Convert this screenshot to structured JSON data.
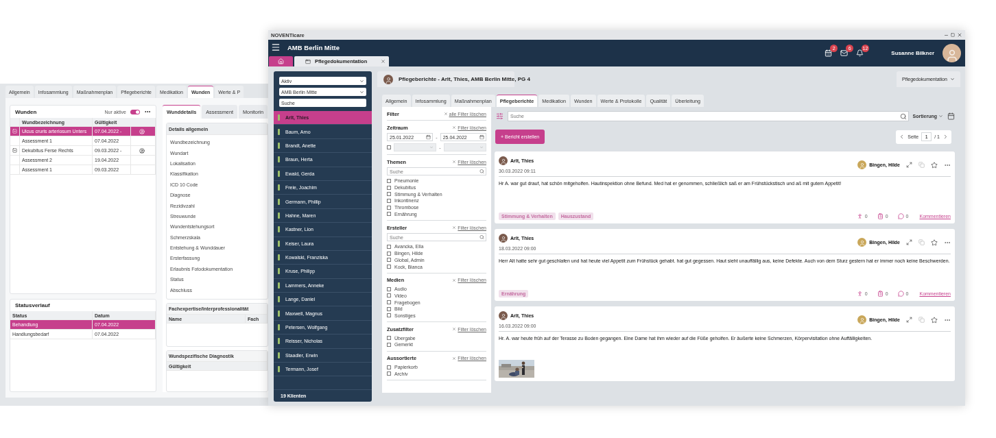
{
  "back_window": {
    "tabs": [
      {
        "label": "Allgemein",
        "selected": false
      },
      {
        "label": "Infosammlung",
        "selected": false
      },
      {
        "label": "Maßnahmenplan",
        "selected": false
      },
      {
        "label": "Pflegeberichte",
        "selected": false
      },
      {
        "label": "Medikation",
        "selected": false
      },
      {
        "label": "Wunden",
        "selected": true
      },
      {
        "label": "Werte & P",
        "selected": false
      }
    ],
    "wounds": {
      "title": "Wunden",
      "toggle_label": "Nur aktive",
      "toggle_on": true,
      "columns": [
        "Wundbezeichnung",
        "Gültigkeit"
      ],
      "rows": [
        {
          "name": "Ulcus cruris arteriosum Unters",
          "date": "07.04.2022 -",
          "selected": true,
          "expanded": true,
          "children": [
            {
              "name": "Assessment 1",
              "date": "07.04.2022",
              "selected": false
            }
          ]
        },
        {
          "name": "Dekubitus Ferse Rechts",
          "date": "09.03.2022 -",
          "selected": false,
          "expanded": true,
          "children": [
            {
              "name": "Assessment 2",
              "date": "19.04.2022",
              "selected": false
            },
            {
              "name": "Assessment 1",
              "date": "09.03.2022",
              "selected": false
            }
          ]
        }
      ]
    },
    "status": {
      "title": "Statusverlauf",
      "columns": [
        "Status",
        "Datum"
      ],
      "rows": [
        {
          "status": "Behandlung",
          "date": "07.04.2022",
          "selected": true
        },
        {
          "status": "Handlungsbedarf",
          "date": "07.04.2022",
          "selected": false
        }
      ]
    },
    "detail_tabs": [
      {
        "label": "Wunddetails",
        "selected": true
      },
      {
        "label": "Assessment",
        "selected": false
      },
      {
        "label": "Monitorin",
        "selected": false
      }
    ],
    "details": {
      "title": "Details allgemein",
      "fields": [
        "Wundbezeichnung",
        "Wundart",
        "Lokalisation",
        "Klassifikation",
        "ICD 10 Code",
        "Diagnose",
        "Rezidivzahl",
        "Streuwunde",
        "Wundentstehungsort",
        "Schmerzskala",
        "Entstehung & Wunddauer",
        "Ersterfassung",
        "Erlaubnis Fotodokumentation",
        "Status",
        "Abschluss"
      ]
    },
    "expertise": {
      "title": "Fachexpertise/Interprofessionalität",
      "columns": [
        "Name",
        "Fach"
      ]
    },
    "diagnostics": {
      "title": "Wundspezifische Diagnostik",
      "columns": [
        "Gültigkeit"
      ]
    }
  },
  "window": {
    "title": "NOVENTIcare",
    "location": "AMB Berlin Mitte",
    "doc_tab": "Pflegedokumentation",
    "user": "Susanne Bilkner",
    "notifications": [
      {
        "kind": "calendar",
        "count": "2"
      },
      {
        "kind": "mail",
        "count": "6"
      },
      {
        "kind": "bell",
        "count": "12"
      }
    ]
  },
  "clients": {
    "status_select": "Aktiv",
    "location_select": "AMB Berlin Mitte",
    "search_placeholder": "Suche",
    "items": [
      {
        "name": "Arlt, Thies",
        "selected": true
      },
      {
        "name": "Baum, Arno",
        "selected": false
      },
      {
        "name": "Brandt, Anette",
        "selected": false
      },
      {
        "name": "Braun, Herta",
        "selected": false
      },
      {
        "name": "Ewald, Gerda",
        "selected": false
      },
      {
        "name": "Freie, Joachim",
        "selected": false
      },
      {
        "name": "Germann, Phillip",
        "selected": false
      },
      {
        "name": "Hahne, Maren",
        "selected": false
      },
      {
        "name": "Kastner, Lion",
        "selected": false
      },
      {
        "name": "Keiser, Laura",
        "selected": false
      },
      {
        "name": "Kowalski, Franziska",
        "selected": false
      },
      {
        "name": "Kruse, Philipp",
        "selected": false
      },
      {
        "name": "Lammers, Anneke",
        "selected": false
      },
      {
        "name": "Lange, Daniel",
        "selected": false
      },
      {
        "name": "Maxwell, Magnus",
        "selected": false
      },
      {
        "name": "Petersen, Wolfgang",
        "selected": false
      },
      {
        "name": "Reisser, Nicholas",
        "selected": false
      },
      {
        "name": "Staadler, Erwin",
        "selected": false
      },
      {
        "name": "Termann, Josef",
        "selected": false
      }
    ],
    "footer": "19 Klienten"
  },
  "header": {
    "title": "Pflegeberichte - Arlt, Thies, AMB Berlin Mitte, PG 4",
    "module": "Pflegedokumentation"
  },
  "tabs": [
    {
      "label": "Allgemein",
      "selected": false
    },
    {
      "label": "Infosammlung",
      "selected": false
    },
    {
      "label": "Maßnahmenplan",
      "selected": false
    },
    {
      "label": "Pflegeberichte",
      "selected": true
    },
    {
      "label": "Medikation",
      "selected": false
    },
    {
      "label": "Wunden",
      "selected": false
    },
    {
      "label": "Werte & Protokolle",
      "selected": false
    },
    {
      "label": "Qualität",
      "selected": false
    },
    {
      "label": "Überleitung",
      "selected": false
    }
  ],
  "filter": {
    "title": "Filter",
    "clear_all": "alle Filter löschen",
    "sections": [
      {
        "kind": "dates",
        "title": "Zeitraum",
        "clear": "Filter löschen",
        "from": "25.01.2022",
        "to": "25.04.2022",
        "separator": "-",
        "time_enabled": false
      },
      {
        "kind": "checklist",
        "title": "Themen",
        "clear": "Filter löschen",
        "search_placeholder": "Suche",
        "options": [
          {
            "label": "Pneumonie",
            "checked": false
          },
          {
            "label": "Dekubitus",
            "checked": false
          },
          {
            "label": "Stimmung & Verhalten",
            "checked": false
          },
          {
            "label": "Inkontinenz",
            "checked": false
          },
          {
            "label": "Thrombose",
            "checked": false
          },
          {
            "label": "Ernährung",
            "checked": false
          }
        ]
      },
      {
        "kind": "checklist",
        "title": "Ersteller",
        "clear": "Filter löschen",
        "search_placeholder": "Suche",
        "options": [
          {
            "label": "Avancka, Ella",
            "checked": false
          },
          {
            "label": "Bingen, Hilde",
            "checked": false
          },
          {
            "label": "Global, Admin",
            "checked": false
          },
          {
            "label": "Kock, Bianca",
            "checked": false
          }
        ]
      },
      {
        "kind": "checklist",
        "title": "Medien",
        "clear": "Filter löschen",
        "options": [
          {
            "label": "Audio",
            "checked": false
          },
          {
            "label": "Video",
            "checked": false
          },
          {
            "label": "Fragebogen",
            "checked": false
          },
          {
            "label": "Bild",
            "checked": false
          },
          {
            "label": "Sonstiges",
            "checked": false
          }
        ]
      },
      {
        "kind": "checklist",
        "title": "Zusatzfilter",
        "clear": "Filter löschen",
        "options": [
          {
            "label": "Übergabe",
            "checked": false
          },
          {
            "label": "Gemerkt",
            "checked": false
          }
        ]
      },
      {
        "kind": "checklist",
        "title": "Aussortierte",
        "clear": "Filter löschen",
        "options": [
          {
            "label": "Papierkorb",
            "checked": false
          },
          {
            "label": "Archiv",
            "checked": false
          }
        ]
      }
    ]
  },
  "toolbar": {
    "search_placeholder": "Suche",
    "sort": "Sortierung",
    "create": "+ Bericht erstellen",
    "page_label": "Seite",
    "page": "1",
    "page_total": "/ 1"
  },
  "reports": [
    {
      "author": "Arlt, Thies",
      "date": "30.03.2022 09:11",
      "assignee": "Bingen, Hilde",
      "text": "Hr A. war gut drauf, hat schön mitgeholfen. Hautinspektion ohne Befund. Med hat er genommen, schließlich saß er am Frühstückstisch und aß mit gutem Appetit!",
      "tags": [
        "Stimmung & Verhalten",
        "Hauszustand"
      ],
      "counts": [
        {
          "kind": "persons",
          "value": "0"
        },
        {
          "kind": "tasks",
          "value": "0"
        },
        {
          "kind": "comments",
          "value": "0"
        }
      ],
      "comment": "Kommentieren"
    },
    {
      "author": "Arlt, Thies",
      "date": "18.03.2022 09:00",
      "assignee": "Bingen, Hilde",
      "text": "Herr Alt hatte sehr gut geschlafen und hat heute viel Appetit zum Frühstück gehabt. hat gut gegessen. Haut sieht unauffällig aus, keine Defekte. Auch von dem Sturz gestern hat er immer noch keine Beschwerden.",
      "tags": [
        "Ernährung"
      ],
      "counts": [
        {
          "kind": "persons",
          "value": "0"
        },
        {
          "kind": "tasks",
          "value": "0"
        },
        {
          "kind": "comments",
          "value": "0"
        }
      ],
      "comment": "Kommentieren"
    },
    {
      "author": "Arlt, Thies",
      "date": "16.03.2022 09:00",
      "assignee": "Bingen, Hilde",
      "text": "Hr. A. war heute früh auf der Terasse zu Boden gegangen. Eine Dame hat ihm wieder auf die Füße geholfen. Er äußerte keine Schmerzen, Körpervisitation ohne Auffälligkeiten."
    }
  ]
}
